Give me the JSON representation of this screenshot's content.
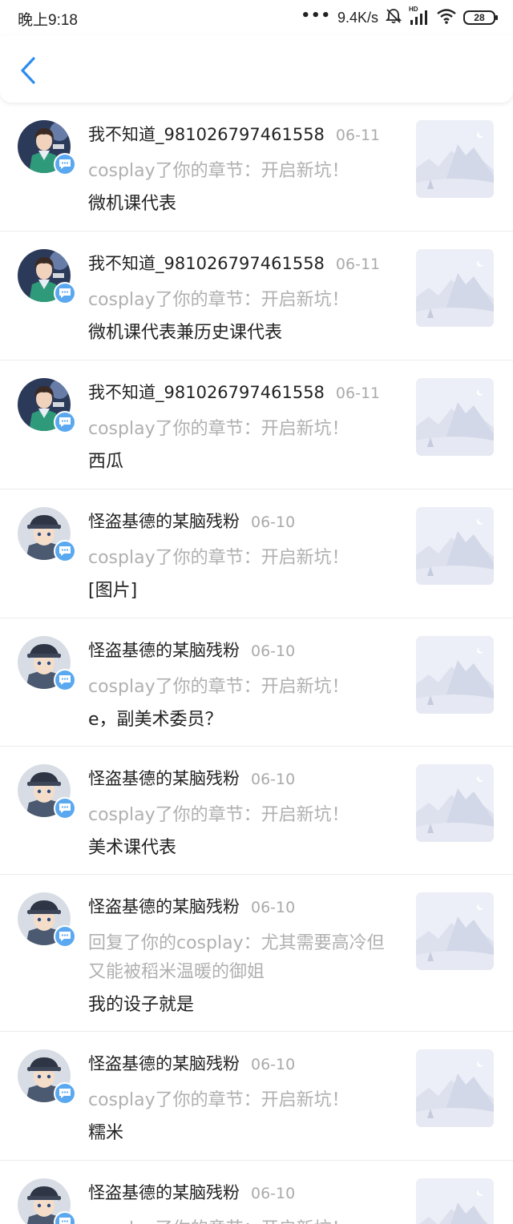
{
  "status_bar": {
    "time": "晚上9:18",
    "dots": "•••",
    "net_speed": "9.4K/s",
    "network_badge": "HD",
    "battery": "28",
    "icons": [
      "bell-muted-icon",
      "signal-icon",
      "wifi-icon",
      "battery-icon"
    ]
  },
  "nav": {
    "back_icon": "chevron-left-icon",
    "accent": "#2d8cf0"
  },
  "colors": {
    "badge": "#5aa8f0",
    "muted": "#b0b0b0",
    "text": "#222222"
  },
  "notifications": [
    {
      "name": "我不知道_981026797461558",
      "date": "06-11",
      "action": "cosplay了你的章节：开启新坑！",
      "message": "微机课代表",
      "avatar": "avatar-green-character"
    },
    {
      "name": "我不知道_981026797461558",
      "date": "06-11",
      "action": "cosplay了你的章节：开启新坑！",
      "message": "微机课代表兼历史课代表",
      "avatar": "avatar-green-character"
    },
    {
      "name": "我不知道_981026797461558",
      "date": "06-11",
      "action": "cosplay了你的章节：开启新坑！",
      "message": "西瓜",
      "avatar": "avatar-green-character"
    },
    {
      "name": "怪盗基德的某脑残粉",
      "date": "06-10",
      "action": "cosplay了你的章节：开启新坑！",
      "message": "[图片]",
      "avatar": "avatar-cap-character"
    },
    {
      "name": "怪盗基德的某脑残粉",
      "date": "06-10",
      "action": "cosplay了你的章节：开启新坑！",
      "message": "e，副美术委员？",
      "avatar": "avatar-cap-character"
    },
    {
      "name": "怪盗基德的某脑残粉",
      "date": "06-10",
      "action": "cosplay了你的章节：开启新坑！",
      "message": "美术课代表",
      "avatar": "avatar-cap-character"
    },
    {
      "name": "怪盗基德的某脑残粉",
      "date": "06-10",
      "action": "回复了你的cosplay：尤其需要高冷但又能被稻米温暖的御姐",
      "message": "我的设子就是",
      "avatar": "avatar-cap-character"
    },
    {
      "name": "怪盗基德的某脑残粉",
      "date": "06-10",
      "action": "cosplay了你的章节：开启新坑！",
      "message": "糯米",
      "avatar": "avatar-cap-character"
    },
    {
      "name": "怪盗基德的某脑残粉",
      "date": "06-10",
      "action": "cosplay了你的章节：开启新坑！",
      "message": "",
      "avatar": "avatar-cap-character"
    }
  ]
}
